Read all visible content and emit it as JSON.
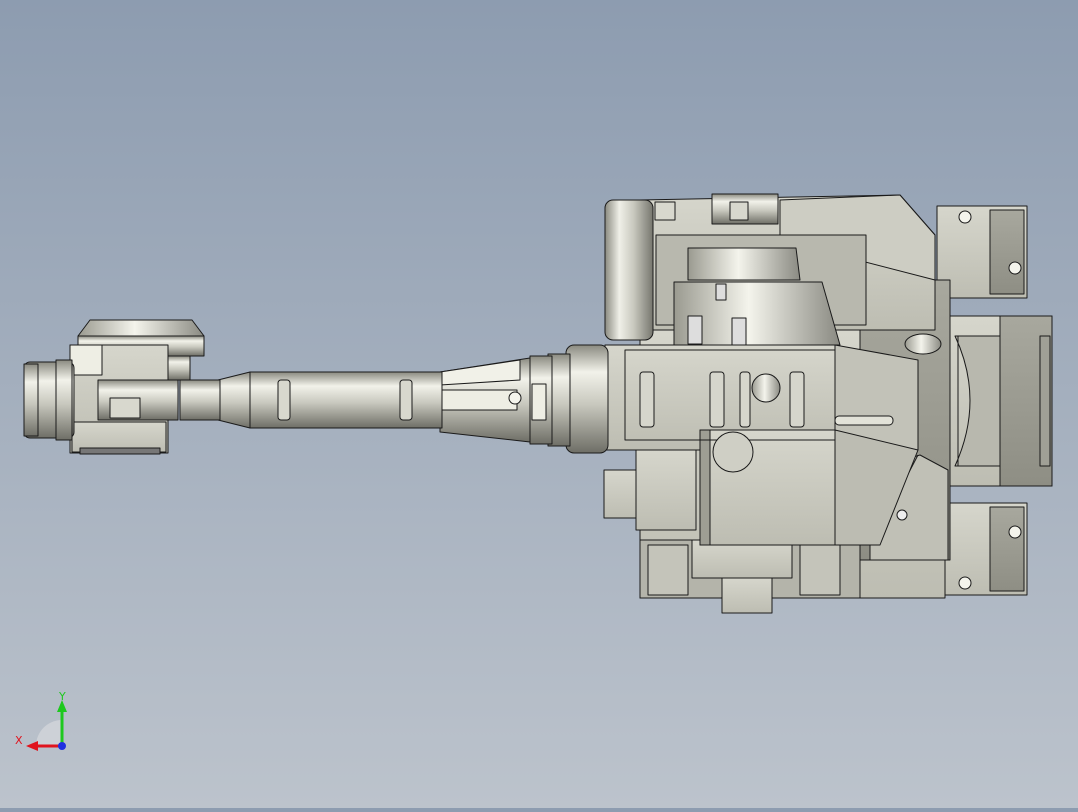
{
  "viewport": {
    "background_top": "#8d9cb0",
    "background_bottom": "#bcc3cc"
  },
  "model": {
    "body_color": "#c9c9bf",
    "edge_color": "#1a1a1a"
  },
  "triad": {
    "x_label": "X",
    "y_label": "Y",
    "x_color": "#e0141e",
    "y_color": "#1ec81e",
    "z_color": "#2030e0"
  }
}
